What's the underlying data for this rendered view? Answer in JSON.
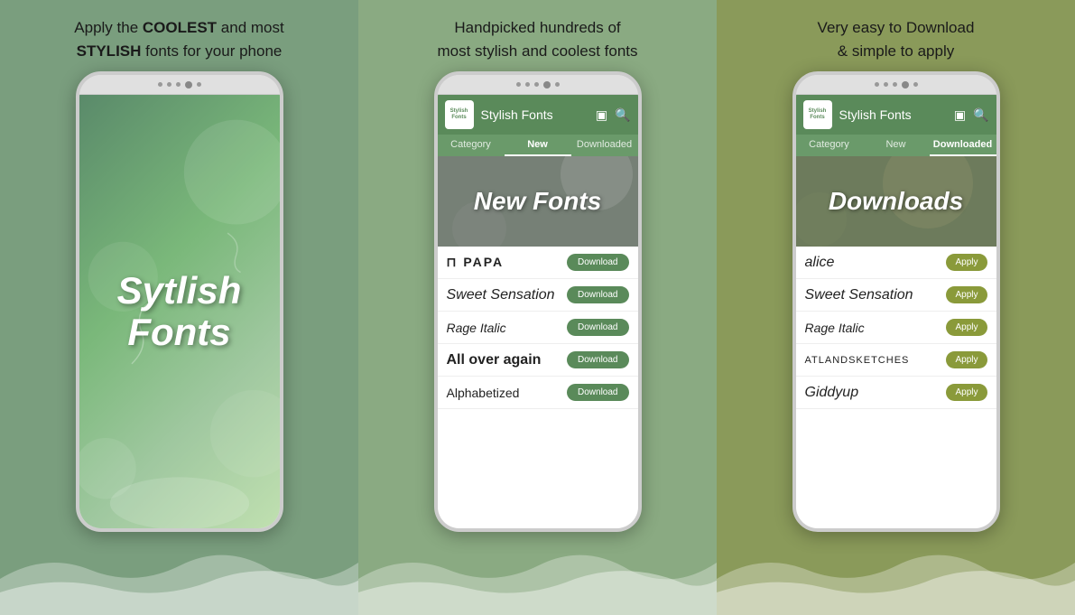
{
  "panels": [
    {
      "id": "panel-1",
      "bg_color": "#7a9e7e",
      "text_line1": "Apply the ",
      "text_bold": "COOLEST",
      "text_line2": " and most",
      "text_line3": "STYLISH",
      "text_rest": " fonts for your phone",
      "description": "Apply the COOLEST and most STYLISH fonts for your phone",
      "screen_type": "splash",
      "splash_title_line1": "Sytlish",
      "splash_title_line2": "Fonts"
    },
    {
      "id": "panel-2",
      "bg_color": "#8aaa82",
      "description": "Handpicked hundreds of most stylish and coolest fonts",
      "screen_type": "app_new",
      "app_title": "Stylish Fonts",
      "logo_text": "Stylish\nFonts",
      "tabs": [
        "Category",
        "New",
        "Downloaded"
      ],
      "active_tab": "New",
      "banner_title": "New Fonts",
      "font_items": [
        {
          "name": "⊓ PAPA",
          "name_style": "special",
          "action": "Download"
        },
        {
          "name": "Sweet Sensation",
          "name_style": "decorative",
          "action": "Download"
        },
        {
          "name": "Rage Italic",
          "name_style": "italic",
          "action": "Download"
        },
        {
          "name": "All over again",
          "name_style": "bold-decorative",
          "action": "Download"
        },
        {
          "name": "Alphabetized",
          "name_style": "normal",
          "action": "Download"
        }
      ]
    },
    {
      "id": "panel-3",
      "bg_color": "#8a9a5a",
      "description": "Very easy to Download & simple to apply",
      "screen_type": "app_downloaded",
      "app_title": "Stylish Fonts",
      "logo_text": "Stylish\nFonts",
      "tabs": [
        "Category",
        "New",
        "Downloaded"
      ],
      "active_tab": "Downloaded",
      "banner_title": "Downloads",
      "font_items": [
        {
          "name": "alice",
          "name_style": "decorative",
          "action": "Apply"
        },
        {
          "name": "Sweet Sensation",
          "name_style": "decorative",
          "action": "Apply"
        },
        {
          "name": "Rage Italic",
          "name_style": "italic",
          "action": "Apply"
        },
        {
          "name": "ATLANDSKETCHES",
          "name_style": "caps",
          "action": "Apply"
        },
        {
          "name": "Giddyup",
          "name_style": "decorative",
          "action": "Apply"
        }
      ]
    }
  ],
  "buttons": {
    "download_label": "Download",
    "apply_label": "Apply"
  }
}
